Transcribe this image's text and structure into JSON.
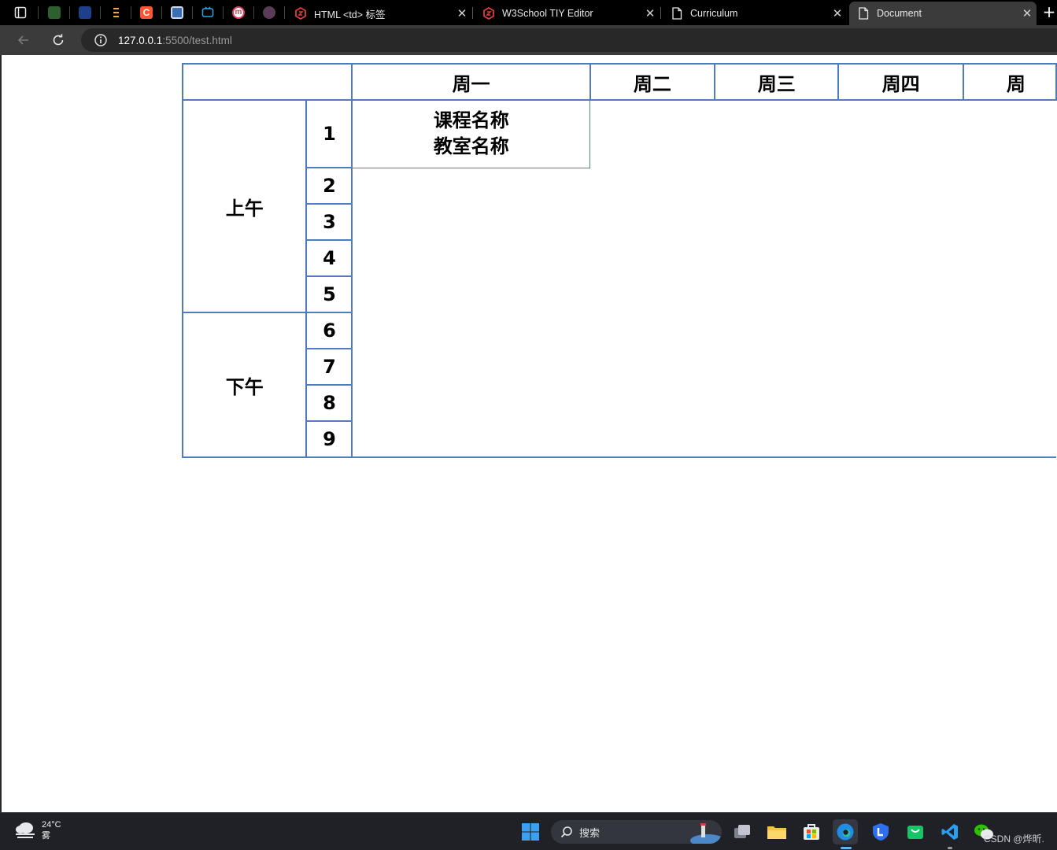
{
  "browser": {
    "tabs": [
      {
        "title": "HTML <td> 标签",
        "favicon": "w3school-icon",
        "active": false
      },
      {
        "title": "W3School TIY Editor",
        "favicon": "w3school-icon",
        "active": false
      },
      {
        "title": "Curriculum",
        "favicon": "document-icon",
        "active": false
      },
      {
        "title": "Document",
        "favicon": "document-icon",
        "active": true
      }
    ],
    "close_glyph": "✕",
    "new_tab_glyph": "+",
    "address": {
      "host": "127.0.0.1",
      "rest": ":5500/test.html"
    }
  },
  "timetable": {
    "days": [
      "周一",
      "周二",
      "周三",
      "周四",
      "周"
    ],
    "periods": {
      "morning": {
        "label": "上午",
        "slots": [
          "1",
          "2",
          "3",
          "4",
          "5"
        ]
      },
      "afternoon": {
        "label": "下午",
        "slots": [
          "6",
          "7",
          "8",
          "9"
        ]
      }
    },
    "course": {
      "name": "课程名称",
      "room": "教室名称"
    },
    "colors": {
      "border": "#4f7cc0"
    }
  },
  "taskbar": {
    "weather": {
      "temp": "24°C",
      "condition": "雾"
    },
    "search_label": "搜索",
    "watermark": "CSDN @烨昕."
  }
}
